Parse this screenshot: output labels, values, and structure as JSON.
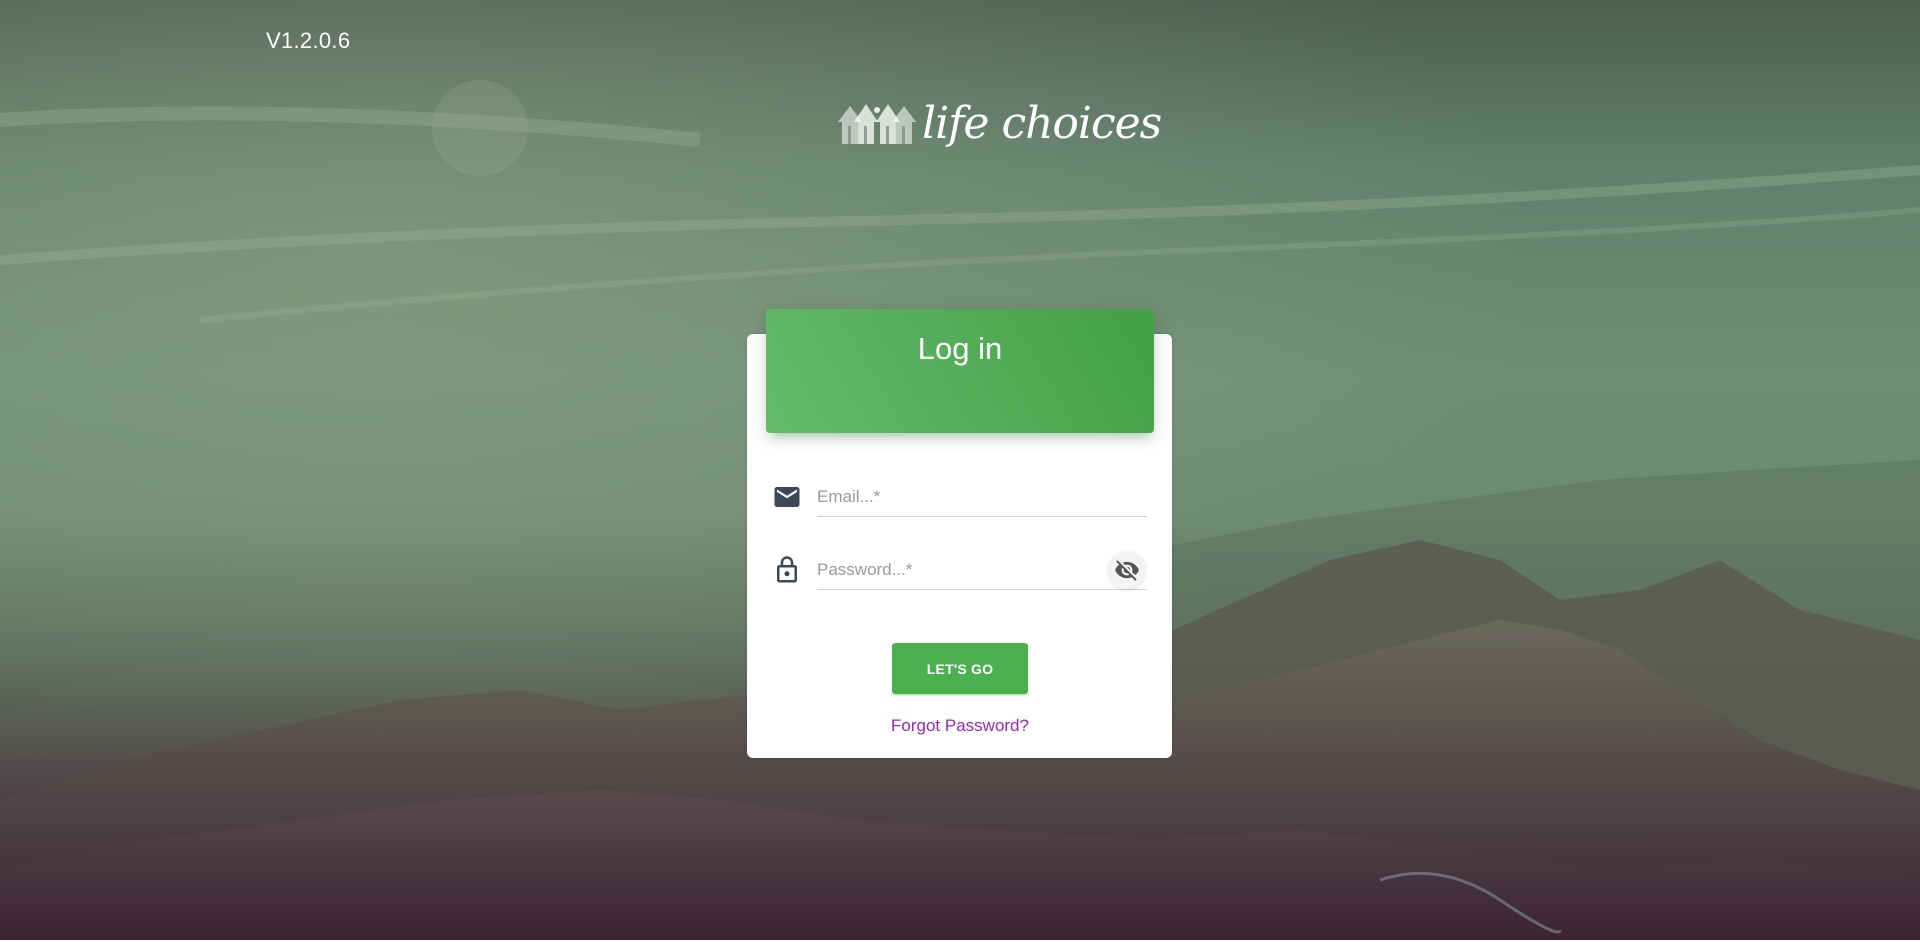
{
  "app": {
    "version": "V1.2.0.6",
    "brand_name": "life choices"
  },
  "login": {
    "title": "Log in",
    "email": {
      "placeholder": "Email...*",
      "value": "",
      "icon": "email-icon"
    },
    "password": {
      "placeholder": "Password...*",
      "value": "",
      "icon": "lock-icon",
      "toggle_icon": "eye-off-icon"
    },
    "submit_label": "LET'S GO",
    "forgot_label": "Forgot Password?"
  },
  "colors": {
    "primary_green": "#4caf50",
    "link_purple": "#9c27b0"
  }
}
